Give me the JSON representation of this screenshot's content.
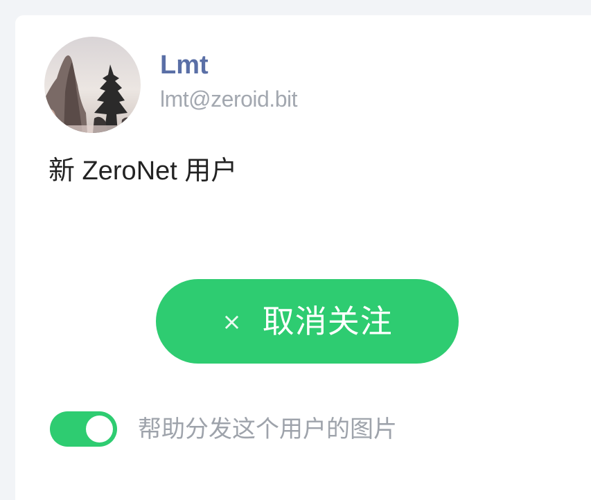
{
  "profile": {
    "name": "Lmt",
    "handle": "lmt@zeroid.bit",
    "bio": "新 ZeroNet 用户",
    "avatar_icon": "landscape-avatar"
  },
  "follow_button": {
    "icon": "close-icon",
    "icon_glyph": "×",
    "label": "取消关注",
    "color": "#2ecc71"
  },
  "seed_toggle": {
    "checked": true,
    "label": "帮助分发这个用户的图片",
    "color": "#2ecc71"
  }
}
